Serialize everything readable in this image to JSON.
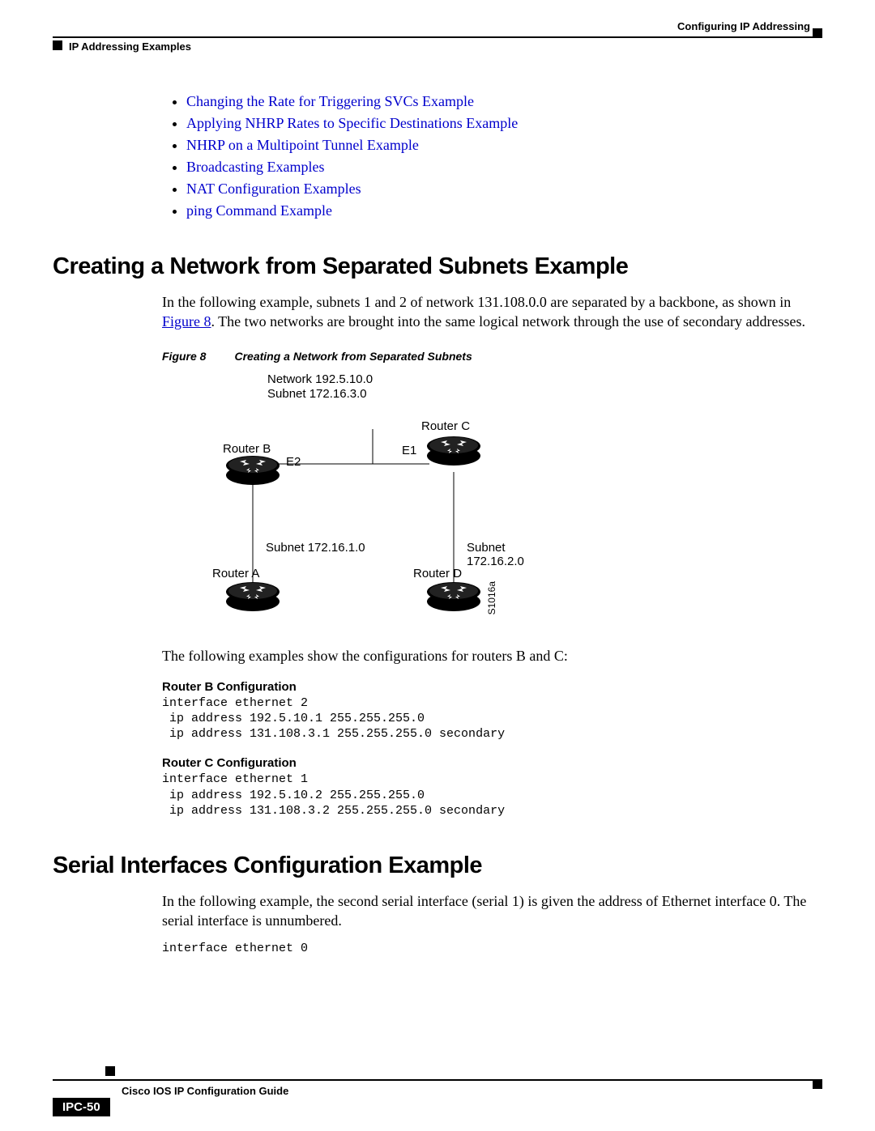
{
  "header": {
    "right": "Configuring IP Addressing",
    "left": "IP Addressing Examples"
  },
  "links": [
    "Changing the Rate for Triggering SVCs Example",
    "Applying NHRP Rates to Specific Destinations Example",
    "NHRP on a Multipoint Tunnel Example",
    "Broadcasting Examples",
    "NAT Configuration Examples",
    "ping Command Example"
  ],
  "section1": {
    "title": "Creating a Network from Separated Subnets Example",
    "para1a": "In the following example, subnets 1 and 2 of network 131.108.0.0 are separated by a backbone, as shown in ",
    "figref": "Figure 8",
    "para1b": ". The two networks are brought into the same logical network through the use of secondary addresses.",
    "figcaption_num": "Figure 8",
    "figcaption_txt": "Creating a Network from Separated Subnets",
    "diagram": {
      "net1": "Network 192.5.10.0",
      "net2": "Subnet 172.16.3.0",
      "routerB": "Router B",
      "routerC": "Router C",
      "routerA": "Router A",
      "routerD": "Router D",
      "e1": "E1",
      "e2": "E2",
      "sub1": "Subnet 172.16.1.0",
      "sub2": "Subnet 172.16.2.0",
      "code": "S1016a"
    },
    "para2": "The following examples show the configurations for routers B and C:",
    "subB": "Router B Configuration",
    "codeB": "interface ethernet 2\n ip address 192.5.10.1 255.255.255.0\n ip address 131.108.3.1 255.255.255.0 secondary",
    "subC": "Router C Configuration",
    "codeC": "interface ethernet 1\n ip address 192.5.10.2 255.255.255.0\n ip address 131.108.3.2 255.255.255.0 secondary"
  },
  "section2": {
    "title": "Serial Interfaces Configuration Example",
    "para": "In the following example, the second serial interface (serial 1) is given the address of Ethernet interface 0. The serial interface is unnumbered.",
    "code": "interface ethernet 0"
  },
  "footer": {
    "title": "Cisco IOS IP Configuration Guide",
    "page": "IPC-50"
  }
}
